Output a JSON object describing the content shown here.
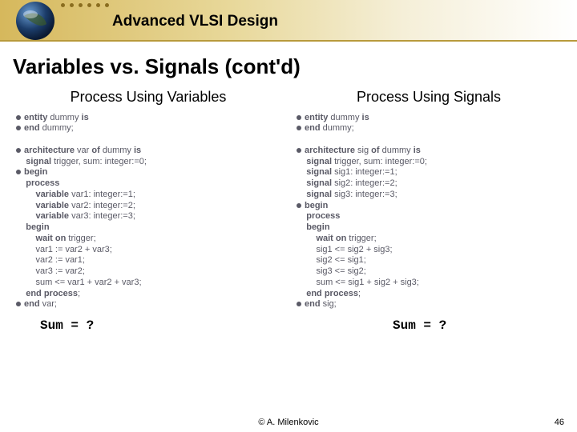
{
  "header": {
    "course_title": "Advanced VLSI Design"
  },
  "slide": {
    "title": "Variables vs. Signals (cont'd)"
  },
  "left": {
    "heading": "Process Using Variables",
    "code": {
      "l1a": "entity",
      "l1b": " dummy ",
      "l1c": "is",
      "l2a": "end",
      "l2b": " dummy;",
      "l3a": "architecture",
      "l3b": " var ",
      "l3c": "of",
      "l3d": " dummy ",
      "l3e": "is",
      "l4a": "    signal",
      "l4b": " trigger, sum: integer:=0;",
      "l5a": "begin",
      "l6a": "    process",
      "l7a": "        variable",
      "l7b": " var1: integer:=1;",
      "l8a": "        variable",
      "l8b": " var2: integer:=2;",
      "l9a": "        variable",
      "l9b": " var3: integer:=3;",
      "l10a": "    begin",
      "l11a": "        wait on",
      "l11b": " trigger;",
      "l12": "        var1 := var2 + var3;",
      "l13": "        var2 := var1;",
      "l14": "        var3 := var2;",
      "l15": "        sum <= var1 + var2 + var3;",
      "l16a": "    end process",
      "l16b": ";",
      "l17a": "end",
      "l17b": " var;"
    },
    "question": "Sum = ?"
  },
  "right": {
    "heading": "Process Using Signals",
    "code": {
      "l1a": "entity",
      "l1b": " dummy ",
      "l1c": "is",
      "l2a": "end",
      "l2b": " dummy;",
      "l3a": "architecture",
      "l3b": " sig ",
      "l3c": "of",
      "l3d": " dummy ",
      "l3e": "is",
      "l4a": "    signal",
      "l4b": " trigger, sum: integer:=0;",
      "l5a": "    signal",
      "l5b": " sig1: integer:=1;",
      "l6a": "    signal",
      "l6b": " sig2: integer:=2;",
      "l7a": "    signal",
      "l7b": " sig3: integer:=3;",
      "l8a": "begin",
      "l9a": "    process",
      "l10a": "    begin",
      "l11a": "        wait on",
      "l11b": " trigger;",
      "l12": "        sig1 <= sig2 + sig3;",
      "l13": "        sig2 <= sig1;",
      "l14": "        sig3 <= sig2;",
      "l15": "        sum <= sig1 + sig2 + sig3;",
      "l16a": "    end process",
      "l16b": ";",
      "l17a": "end",
      "l17b": " sig;"
    },
    "question": "Sum = ?"
  },
  "footer": {
    "copyright": "©  A. Milenkovic",
    "page": "46"
  }
}
